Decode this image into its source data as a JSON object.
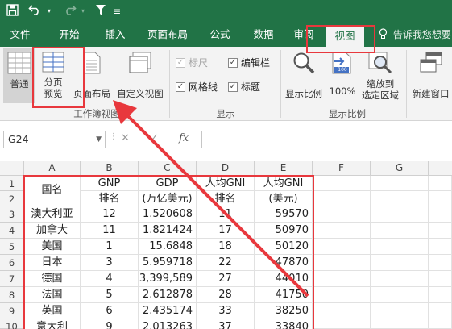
{
  "qat": {
    "save_icon": "save-icon",
    "undo_icon": "undo-icon",
    "redo_icon": "redo-icon",
    "touch_icon": "touch-mode-icon",
    "customize_icon": "customize-qat-icon"
  },
  "tabs": [
    {
      "label": "文件",
      "active": false
    },
    {
      "label": "开始",
      "active": false
    },
    {
      "label": "插入",
      "active": false
    },
    {
      "label": "页面布局",
      "active": false
    },
    {
      "label": "公式",
      "active": false
    },
    {
      "label": "数据",
      "active": false
    },
    {
      "label": "审阅",
      "active": false
    },
    {
      "label": "视图",
      "active": true
    }
  ],
  "tell_me": {
    "icon": "lightbulb-icon",
    "text": "告诉我您想要"
  },
  "ribbon": {
    "workbook_views": {
      "group_label": "工作簿视图",
      "normal": "普通",
      "page_break_line1": "分页",
      "page_break_line2": "预览",
      "page_layout": "页面布局",
      "custom_views": "自定义视图"
    },
    "show": {
      "group_label": "显示",
      "ruler": {
        "label": "标尺",
        "checked": true,
        "enabled": false
      },
      "gridlines": {
        "label": "网格线",
        "checked": true,
        "enabled": true
      },
      "formula_bar": {
        "label": "编辑栏",
        "checked": true,
        "enabled": true
      },
      "headings": {
        "label": "标题",
        "checked": true,
        "enabled": true
      }
    },
    "zoom": {
      "group_label": "显示比例",
      "zoom": "显示比例",
      "hundred": "100%",
      "hundred_badge": "100",
      "selection_line1": "缩放到",
      "selection_line2": "选定区域"
    },
    "window": {
      "new_window": "新建窗口"
    }
  },
  "formula_bar": {
    "name_box": "G24",
    "cancel": "✕",
    "enter": "✓",
    "fx": "fx",
    "content": ""
  },
  "sheet": {
    "columns": [
      "A",
      "B",
      "C",
      "D",
      "E",
      "F",
      "G"
    ],
    "rows": [
      "1",
      "2",
      "3",
      "4",
      "5",
      "6",
      "7",
      "8",
      "9",
      "10"
    ],
    "header": {
      "a": "国名",
      "b1": "GNP",
      "b2": "排名",
      "c1": "GDP",
      "c2": "(万亿美元)",
      "d1": "人均GNI",
      "d2": "排名",
      "e1": "人均GNI",
      "e2": "(美元)"
    },
    "data": [
      [
        "澳大利亚",
        "12",
        "1.520608",
        "11",
        "59570"
      ],
      [
        "加拿大",
        "11",
        "1.821424",
        "17",
        "50970"
      ],
      [
        "美国",
        "1",
        "15.6848",
        "18",
        "50120"
      ],
      [
        "日本",
        "3",
        "5.959718",
        "22",
        "47870"
      ],
      [
        "德国",
        "4",
        "3,399,589",
        "27",
        "44010"
      ],
      [
        "法国",
        "5",
        "2.612878",
        "28",
        "41750"
      ],
      [
        "英国",
        "6",
        "2.435174",
        "33",
        "38250"
      ],
      [
        "意大利",
        "9",
        "2.013263",
        "37",
        "33840"
      ]
    ]
  },
  "colors": {
    "brand_green": "#217346",
    "annotation_red": "#e8383d"
  }
}
